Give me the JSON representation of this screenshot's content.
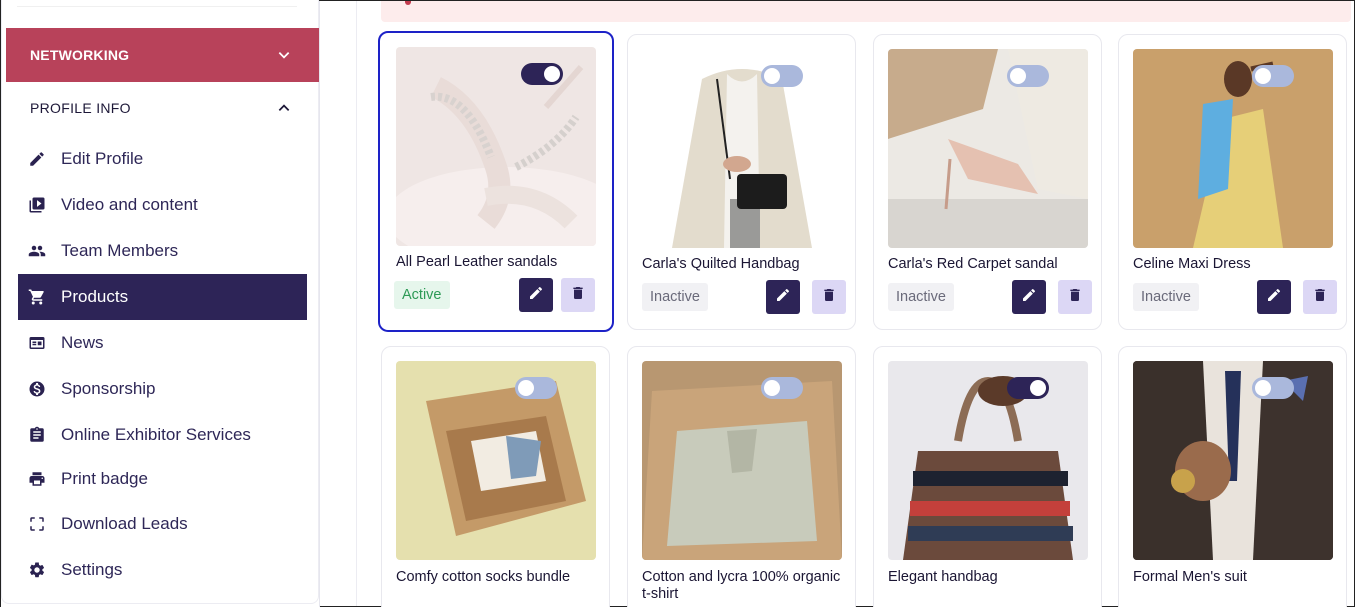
{
  "sidebar": {
    "networking_label": "NETWORKING",
    "profile_info_label": "PROFILE INFO",
    "items": [
      {
        "label": "Edit Profile",
        "icon": "pencil-icon"
      },
      {
        "label": "Video and content",
        "icon": "video-library-icon"
      },
      {
        "label": "Team Members",
        "icon": "people-icon"
      },
      {
        "label": "Products",
        "icon": "cart-icon",
        "active": true
      },
      {
        "label": "News",
        "icon": "news-icon"
      },
      {
        "label": "Sponsorship",
        "icon": "dollar-icon"
      },
      {
        "label": "Online Exhibitor Services",
        "icon": "clipboard-icon"
      },
      {
        "label": "Print badge",
        "icon": "printer-icon"
      },
      {
        "label": "Download Leads",
        "icon": "scan-frame-icon"
      },
      {
        "label": "Settings",
        "icon": "gear-icon"
      }
    ]
  },
  "products": [
    {
      "name": "All Pearl Leather sandals",
      "status": "Active",
      "enabled": true,
      "selected": true
    },
    {
      "name": "Carla's Quilted Handbag",
      "status": "Inactive",
      "enabled": false
    },
    {
      "name": "Carla's Red Carpet sandal",
      "status": "Inactive",
      "enabled": false
    },
    {
      "name": "Celine Maxi Dress",
      "status": "Inactive",
      "enabled": false
    },
    {
      "name": "Comfy cotton socks bundle",
      "enabled": false
    },
    {
      "name": "Cotton and lycra 100% organic t-shirt",
      "enabled": false
    },
    {
      "name": "Elegant handbag",
      "enabled": true
    },
    {
      "name": "Formal Men's suit",
      "enabled": false
    }
  ],
  "colors": {
    "primary": "#2d2457",
    "networking": "#b8425a",
    "selected_border": "#1d22c7",
    "active_badge": "#2d9a56"
  }
}
